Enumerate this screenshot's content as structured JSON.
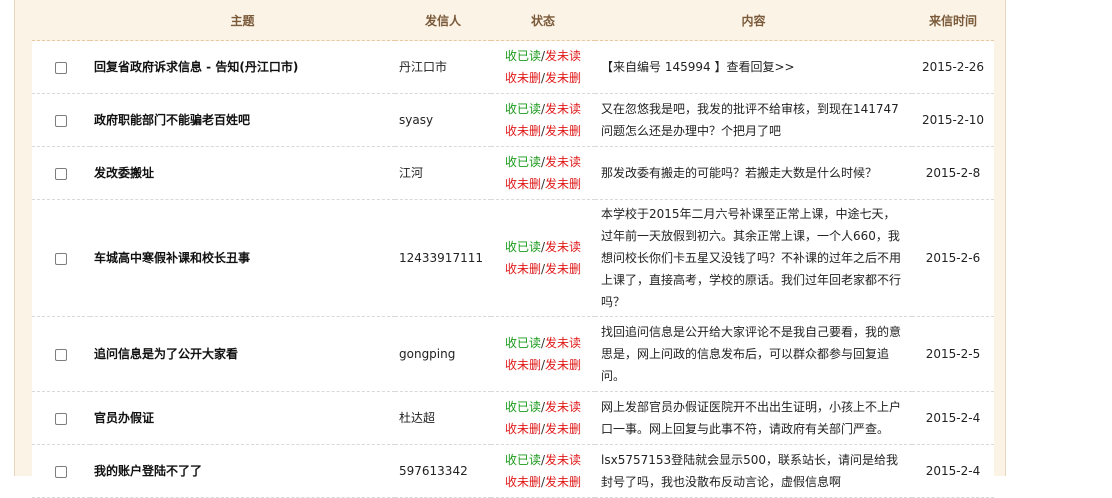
{
  "table": {
    "headers": {
      "subject": "主题",
      "sender": "发信人",
      "status": "状态",
      "content": "内容",
      "time": "来信时间"
    },
    "status_labels": {
      "read": "收已读",
      "slash": "/",
      "unread": "发未读",
      "undeleted": "收未删",
      "sent_undeleted": "发未删"
    },
    "rows": [
      {
        "subject": "回复省政府诉求信息 - 告知(丹江口市)",
        "sender": "丹江口市",
        "content": "【来自编号 145994 】查看回复>>",
        "time": "2015-2-26"
      },
      {
        "subject": "政府职能部门不能骗老百姓吧",
        "sender": "syasy",
        "content": "又在忽悠我是吧，我发的批评不给审核，到现在141747问题怎么还是办理中？个把月了吧",
        "time": "2015-2-10"
      },
      {
        "subject": "发改委搬址",
        "sender": "江河",
        "content": "那发改委有搬走的可能吗？若搬走大数是什么时候？",
        "time": "2015-2-8"
      },
      {
        "subject": "车城高中寒假补课和校长丑事",
        "sender": "12433917111",
        "content": "本学校于2015年二月六号补课至正常上课，中途七天，过年前一天放假到初六。其余正常上课，一个人660，我想问校长你们卡五星又没钱了吗？不补课的过年之后不用上课了，直接高考，学校的原话。我们过年回老家都不行吗？",
        "time": "2015-2-6"
      },
      {
        "subject": "追问信息是为了公开大家看",
        "sender": "gongping",
        "content": "找回追问信息是公开给大家评论不是我自己要看，我的意思是，网上问政的信息发布后，可以群众都参与回复追问。",
        "time": "2015-2-5"
      },
      {
        "subject": "官员办假证",
        "sender": "杜达超",
        "content": "网上发部官员办假证医院开不出出生证明，小孩上不上户口一事。网上回复与此事不符，请政府有关部门严查。",
        "time": "2015-2-4"
      },
      {
        "subject": "我的账户登陆不了了",
        "sender": "597613342",
        "content": "lsx5757153登陆就会显示500，联系站长，请问是给我封号了吗，我也没散布反动言论，虚假信息啊",
        "time": "2015-2-4"
      }
    ]
  }
}
